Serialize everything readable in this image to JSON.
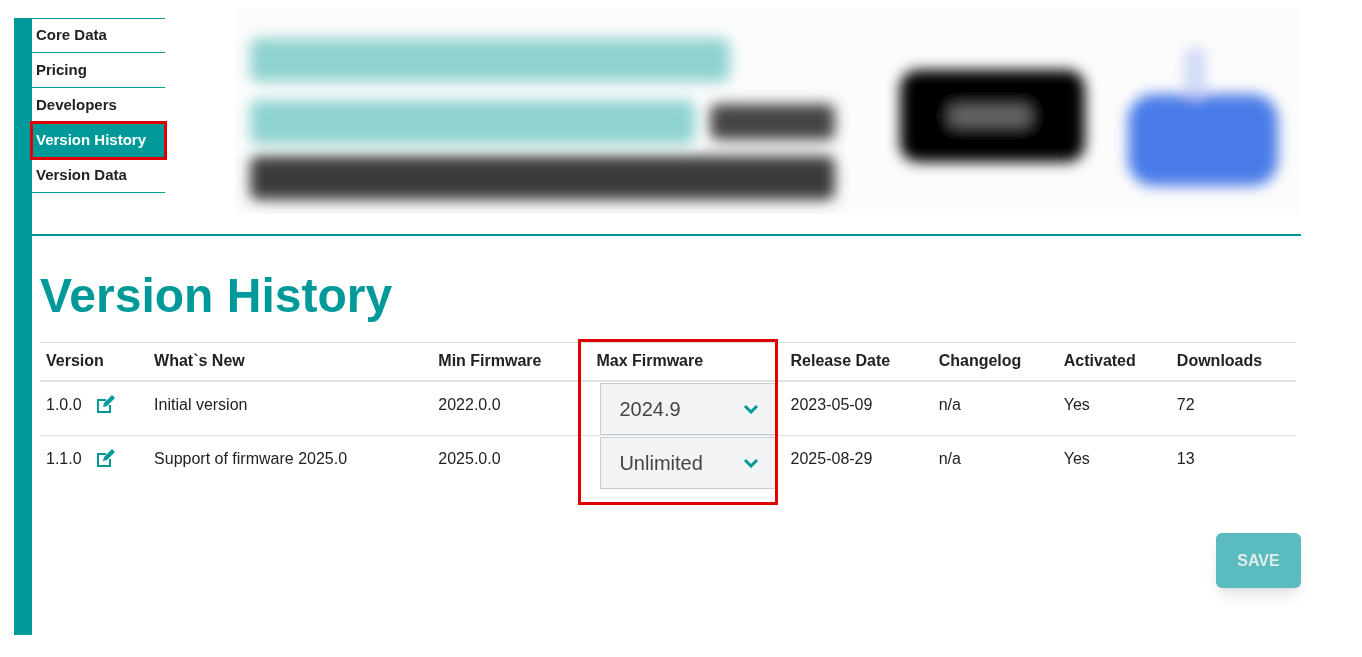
{
  "sidebar": {
    "items": [
      {
        "label": "Core Data",
        "selected": false,
        "highlighted": false
      },
      {
        "label": "Pricing",
        "selected": false,
        "highlighted": false
      },
      {
        "label": "Developers",
        "selected": false,
        "highlighted": false
      },
      {
        "label": "Version History",
        "selected": true,
        "highlighted": true
      },
      {
        "label": "Version Data",
        "selected": false,
        "highlighted": false
      }
    ]
  },
  "heading": "Version History",
  "table": {
    "columns": [
      {
        "label": "Version",
        "highlighted": false
      },
      {
        "label": "What`s New",
        "highlighted": false
      },
      {
        "label": "Min Firmware",
        "highlighted": false
      },
      {
        "label": "Max Firmware",
        "highlighted": true
      },
      {
        "label": "Release Date",
        "highlighted": false
      },
      {
        "label": "Changelog",
        "highlighted": false
      },
      {
        "label": "Activated",
        "highlighted": false
      },
      {
        "label": "Downloads",
        "highlighted": false
      }
    ],
    "rows": [
      {
        "version": "1.0.0",
        "whats_new": "Initial version",
        "min_firmware": "2022.0.0",
        "max_firmware": "2024.9",
        "release_date": "2023-05-09",
        "changelog": "n/a",
        "activated": "Yes",
        "downloads": "72"
      },
      {
        "version": "1.1.0",
        "whats_new": "Support of firmware 2025.0",
        "min_firmware": "2025.0.0",
        "max_firmware": "Unlimited",
        "release_date": "2025-08-29",
        "changelog": "n/a",
        "activated": "Yes",
        "downloads": "13"
      }
    ]
  },
  "save_button": {
    "label": "SAVE",
    "disabled": true
  }
}
